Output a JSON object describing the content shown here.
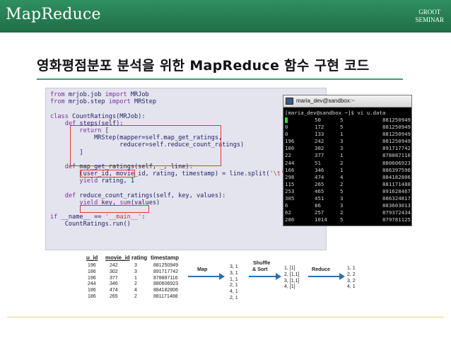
{
  "header": {
    "title": "MapReduce",
    "brand_line1": "GROOT",
    "brand_line2": "SEMINAR"
  },
  "slide": {
    "title": "영화평점분포 분석을 위한 MapReduce 함수 구현 코드"
  },
  "code": {
    "lines": [
      {
        "kw": "from",
        "rest": " mrjob.job ",
        "kw2": "import",
        "rest2": " MRJob"
      },
      {
        "kw": "from",
        "rest": " mrjob.step ",
        "kw2": "import",
        "rest2": " MRStep"
      },
      {
        "kw": "",
        "rest": "",
        "kw2": "",
        "rest2": ""
      },
      {
        "kw": "class",
        "rest": " CountRatings(MRJob):",
        "kw2": "",
        "rest2": ""
      },
      {
        "kw": "    def",
        "rest": " steps(self):",
        "kw2": "",
        "rest2": ""
      },
      {
        "kw": "        return",
        "rest": " [",
        "kw2": "",
        "rest2": ""
      },
      {
        "kw": "",
        "rest": "            MRStep(mapper=self.map_get_ratings,",
        "kw2": "",
        "rest2": ""
      },
      {
        "kw": "",
        "rest": "                   reducer=self.reduce_count_ratings)",
        "kw2": "",
        "rest2": ""
      },
      {
        "kw": "",
        "rest": "        ]",
        "kw2": "",
        "rest2": ""
      },
      {
        "kw": "",
        "rest": "",
        "kw2": "",
        "rest2": ""
      },
      {
        "kw": "    def",
        "rest": " map_get_ratings(self, _, line):",
        "kw2": "",
        "rest2": ""
      },
      {
        "kw": "",
        "rest": "        (user_id, movie_id, rating, timestamp) = line.split(",
        "kw2": "",
        "rest2": "",
        "str": "'\\t'",
        "tail": ")"
      },
      {
        "kw": "        yield",
        "rest": " rating, 1",
        "kw2": "",
        "rest2": ""
      },
      {
        "kw": "",
        "rest": "",
        "kw2": "",
        "rest2": ""
      },
      {
        "kw": "    def",
        "rest": " reduce_count_ratings(self, key, values):",
        "kw2": "",
        "rest2": ""
      },
      {
        "kw": "        yield",
        "rest": " key, ",
        "kw2": "sum",
        "rest2": "(values)"
      },
      {
        "kw": "",
        "rest": "",
        "kw2": "",
        "rest2": ""
      },
      {
        "kw": "if",
        "rest": " __name__ == ",
        "kw2": "",
        "rest2": "",
        "str": "'__main__'",
        "tail": ":"
      },
      {
        "kw": "",
        "rest": "    CountRatings.run()",
        "kw2": "",
        "rest2": ""
      }
    ]
  },
  "terminal": {
    "title": "maria_dev@sandbox:~",
    "prompt": "[maria_dev@sandbox ~]$ vi u.data",
    "rows": [
      [
        "1",
        "50",
        "5",
        "881250949"
      ],
      [
        "0",
        "172",
        "5",
        "881250949"
      ],
      [
        "0",
        "133",
        "1",
        "881250949"
      ],
      [
        "196",
        "242",
        "3",
        "881250949"
      ],
      [
        "186",
        "302",
        "3",
        "891717742"
      ],
      [
        "22",
        "377",
        "1",
        "878887116"
      ],
      [
        "244",
        "51",
        "2",
        "880606923"
      ],
      [
        "166",
        "346",
        "1",
        "886397596"
      ],
      [
        "298",
        "474",
        "4",
        "884182806"
      ],
      [
        "115",
        "265",
        "2",
        "881171488"
      ],
      [
        "253",
        "465",
        "5",
        "891628467"
      ],
      [
        "305",
        "451",
        "3",
        "886324817"
      ],
      [
        "6",
        "86",
        "3",
        "883603013"
      ],
      [
        "62",
        "257",
        "2",
        "879372434"
      ],
      [
        "286",
        "1014",
        "5",
        "879781125"
      ]
    ]
  },
  "table": {
    "headers": [
      "u_id",
      "movie_id",
      "rating",
      "timestamp"
    ],
    "rows": [
      [
        "196",
        "242",
        "3",
        "881250949"
      ],
      [
        "186",
        "302",
        "3",
        "891717742"
      ],
      [
        "196",
        "377",
        "1",
        "878887116"
      ],
      [
        "244",
        "346",
        "2",
        "880606923"
      ],
      [
        "186",
        "474",
        "4",
        "884182806"
      ],
      [
        "186",
        "265",
        "2",
        "881171488"
      ]
    ]
  },
  "flow": {
    "map_label": "Map",
    "map_output": [
      "3, 1",
      "3, 1",
      "1, 1",
      "2, 1",
      "4, 1",
      "2, 1"
    ],
    "shuffle_label_1": "Shuffle",
    "shuffle_label_2": "& Sort",
    "shuffle_output": [
      "1, [1]",
      "2, [1,1]",
      "3, [1,1]",
      "4, [1]"
    ],
    "reduce_label": "Reduce",
    "reduce_output": [
      "1, 1",
      "2, 2",
      "3, 2",
      "4, 1"
    ]
  },
  "colors": {
    "header": "#2a8456",
    "accent": "#3aa06c",
    "highlight": "#e0392d",
    "terminal_green": "#2fdc2f",
    "arrow_blue": "#2a6fb0"
  }
}
